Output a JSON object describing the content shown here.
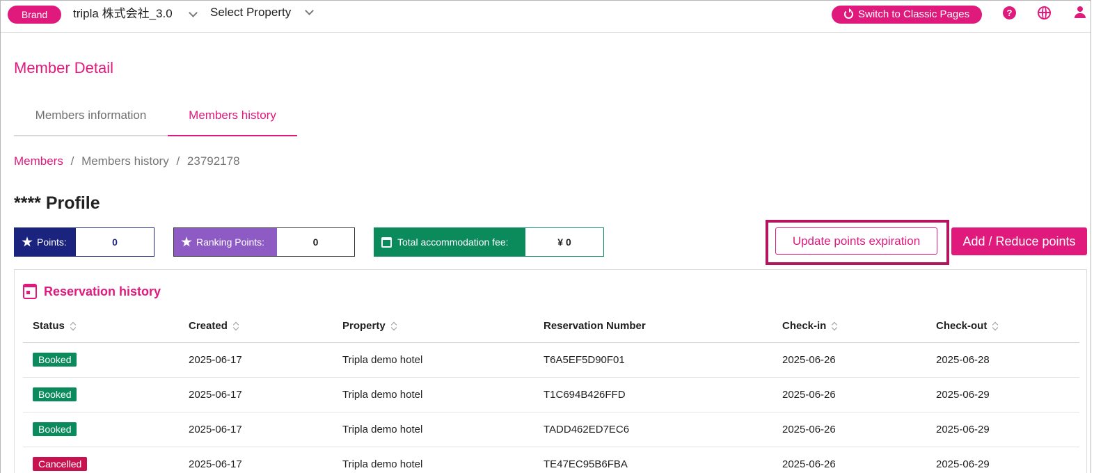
{
  "topbar": {
    "brand_label": "Brand",
    "company": "tripla 株式会社_3.0",
    "select_property": "Select Property",
    "classic_button": "Switch to Classic Pages",
    "help_icon_glyph": "?"
  },
  "page": {
    "title": "Member Detail"
  },
  "tabs": [
    {
      "label": "Members information",
      "active": false
    },
    {
      "label": "Members history",
      "active": true
    }
  ],
  "breadcrumb": {
    "root": "Members",
    "sep": "/",
    "middle": "Members history",
    "current": "23792178"
  },
  "profile": {
    "title": "**** Profile"
  },
  "stats": {
    "points_label": "Points:",
    "points_value": "0",
    "ranking_label": "Ranking Points:",
    "ranking_value": "0",
    "fee_label": "Total accommodation fee:",
    "fee_value": "¥ 0"
  },
  "actions": {
    "update_expiration": "Update points expiration",
    "add_reduce": "Add / Reduce points"
  },
  "reservations": {
    "heading": "Reservation history",
    "columns": [
      "Status",
      "Created",
      "Property",
      "Reservation Number",
      "Check-in",
      "Check-out"
    ],
    "rows": [
      {
        "status": "Booked",
        "created": "2025-06-17",
        "property": "Tripla demo hotel",
        "number": "T6A5EF5D90F01",
        "checkin": "2025-06-26",
        "checkout": "2025-06-28"
      },
      {
        "status": "Booked",
        "created": "2025-06-17",
        "property": "Tripla demo hotel",
        "number": "T1C694B426FFD",
        "checkin": "2025-06-26",
        "checkout": "2025-06-29"
      },
      {
        "status": "Booked",
        "created": "2025-06-17",
        "property": "Tripla demo hotel",
        "number": "TADD462ED7EC6",
        "checkin": "2025-06-26",
        "checkout": "2025-06-29"
      },
      {
        "status": "Cancelled",
        "created": "2025-06-17",
        "property": "Tripla demo hotel",
        "number": "TE47EC95B6FBA",
        "checkin": "2025-06-26",
        "checkout": "2025-06-29"
      }
    ]
  },
  "colors": {
    "accent": "#e0197d",
    "points": "#1a237e",
    "ranking": "#8e5bc4",
    "fee": "#0b8a5c",
    "booked": "#0b8a5c",
    "cancelled": "#c8124f",
    "highlight": "#b3155e"
  }
}
